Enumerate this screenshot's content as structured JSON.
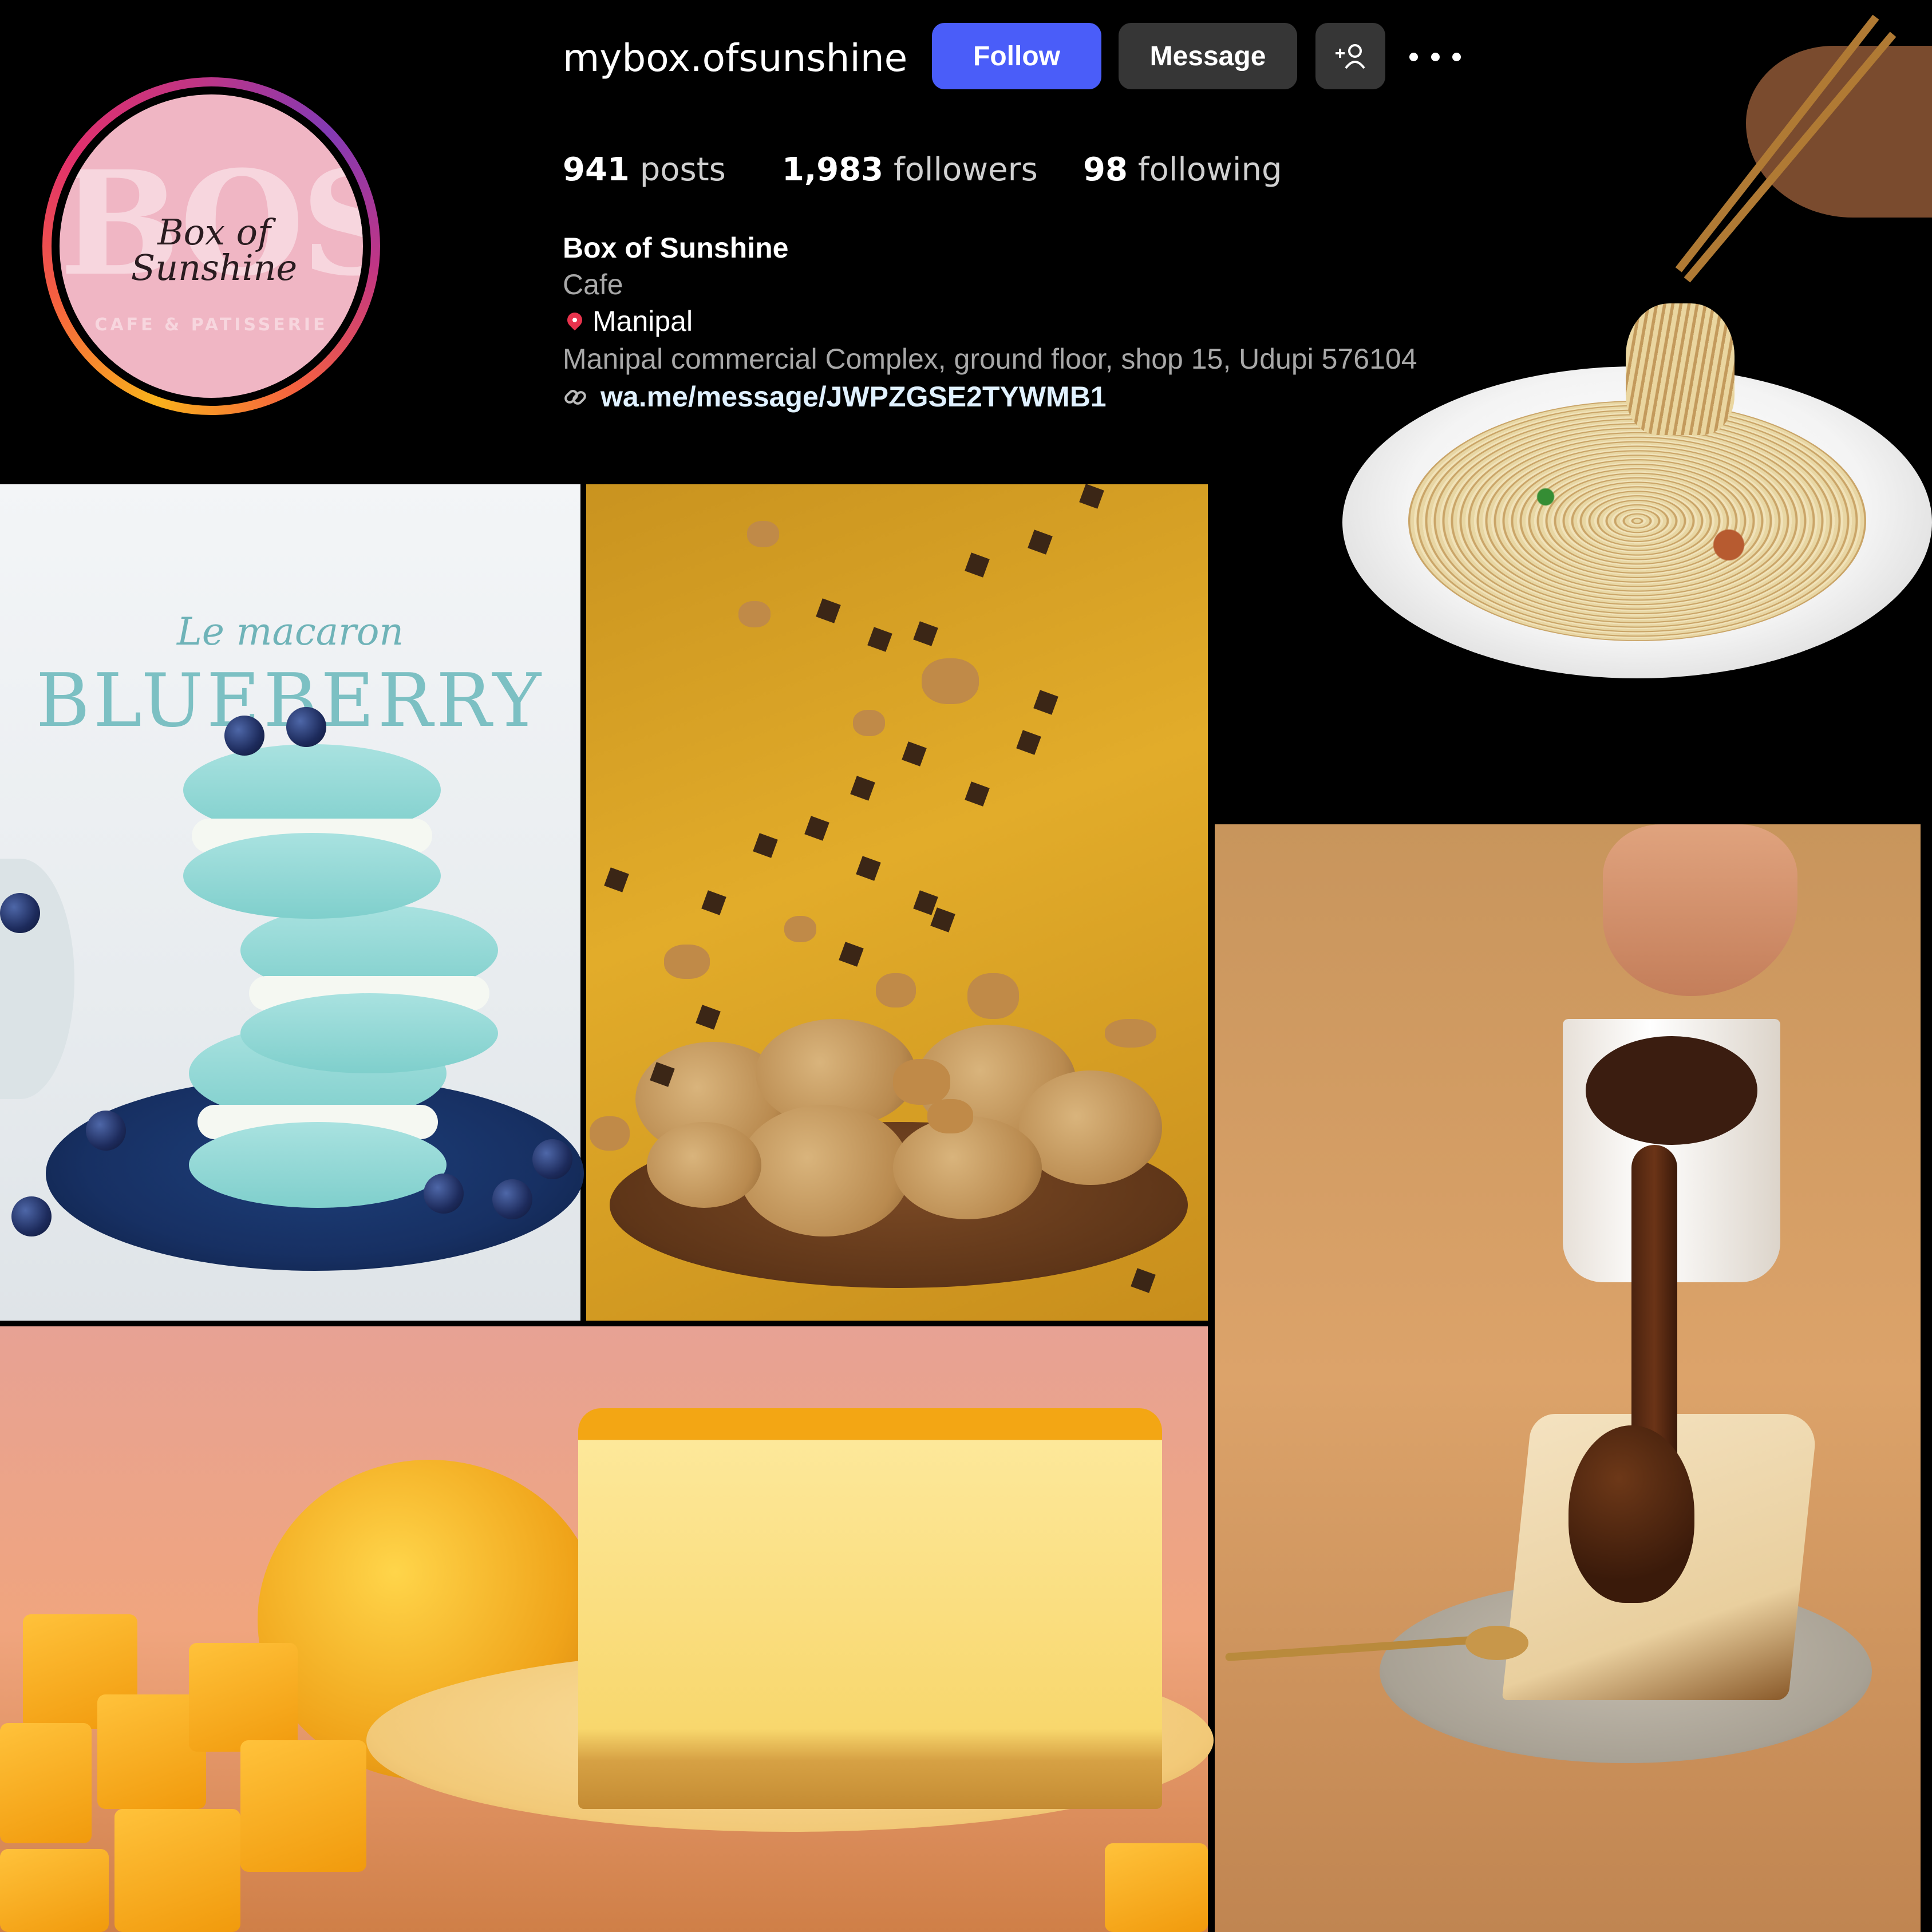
{
  "profile": {
    "username": "mybox.ofsunshine",
    "actions": {
      "follow_label": "Follow",
      "message_label": "Message",
      "add_user_icon": "add-user-icon",
      "more_icon": "more-icon"
    },
    "stats": {
      "posts_count": "941",
      "posts_label": "posts",
      "followers_count": "1,983",
      "followers_label": "followers",
      "following_count": "98",
      "following_label": "following"
    },
    "bio": {
      "name": "Box of Sunshine",
      "category": "Cafe",
      "location": "Manipal",
      "address": "Manipal commercial Complex, ground floor, shop 15, Udupi 576104",
      "link": "wa.me/message/JWPZGSE2TYWMB1",
      "link_icon": "link-icon",
      "location_icon": "pin-icon"
    },
    "avatar": {
      "logo_letters": "BOS",
      "logo_script": "Box of Sunshine",
      "logo_sub": "CAFE & PATISSERIE"
    }
  },
  "posts": {
    "macaron": {
      "script": "Le macaron",
      "title": "BLUEBERRY"
    }
  },
  "colors": {
    "follow_button": "#4a5df9",
    "secondary_button": "#363636",
    "background": "#000000",
    "avatar_pink": "#f0b6c4",
    "macaron_teal": "#7cc0c3"
  }
}
